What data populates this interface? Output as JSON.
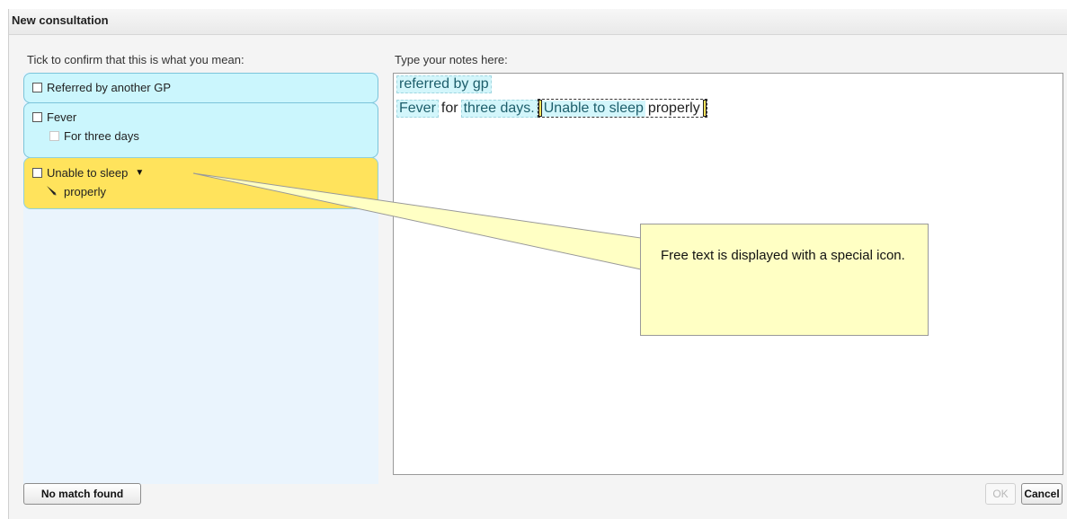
{
  "dialog": {
    "title": "New consultation"
  },
  "left": {
    "heading": "Tick to confirm that this is what you mean:",
    "items": [
      {
        "label": "Referred by another GP"
      },
      {
        "label": "Fever",
        "sub": "For three days"
      },
      {
        "label": "Unable to sleep",
        "sub": "properly",
        "sub_icon": "pen-icon"
      }
    ]
  },
  "notes": {
    "heading": "Type your notes here:",
    "line1": "referred by gp",
    "line2": {
      "t1": "Fever",
      "t2": "for",
      "t3": "three days.",
      "t4": "Unable to sleep",
      "t5": "properly"
    }
  },
  "tooltip": {
    "text": "Free text is displayed with a special icon."
  },
  "buttons": {
    "no_match": "No match found",
    "ok": "OK",
    "cancel": "Cancel"
  },
  "colors": {
    "cyan_card": "#cbf6fd",
    "yellow_card": "#ffe35c",
    "tooltip_bg": "#ffffc4",
    "panel_bg": "#eaf4fd"
  }
}
